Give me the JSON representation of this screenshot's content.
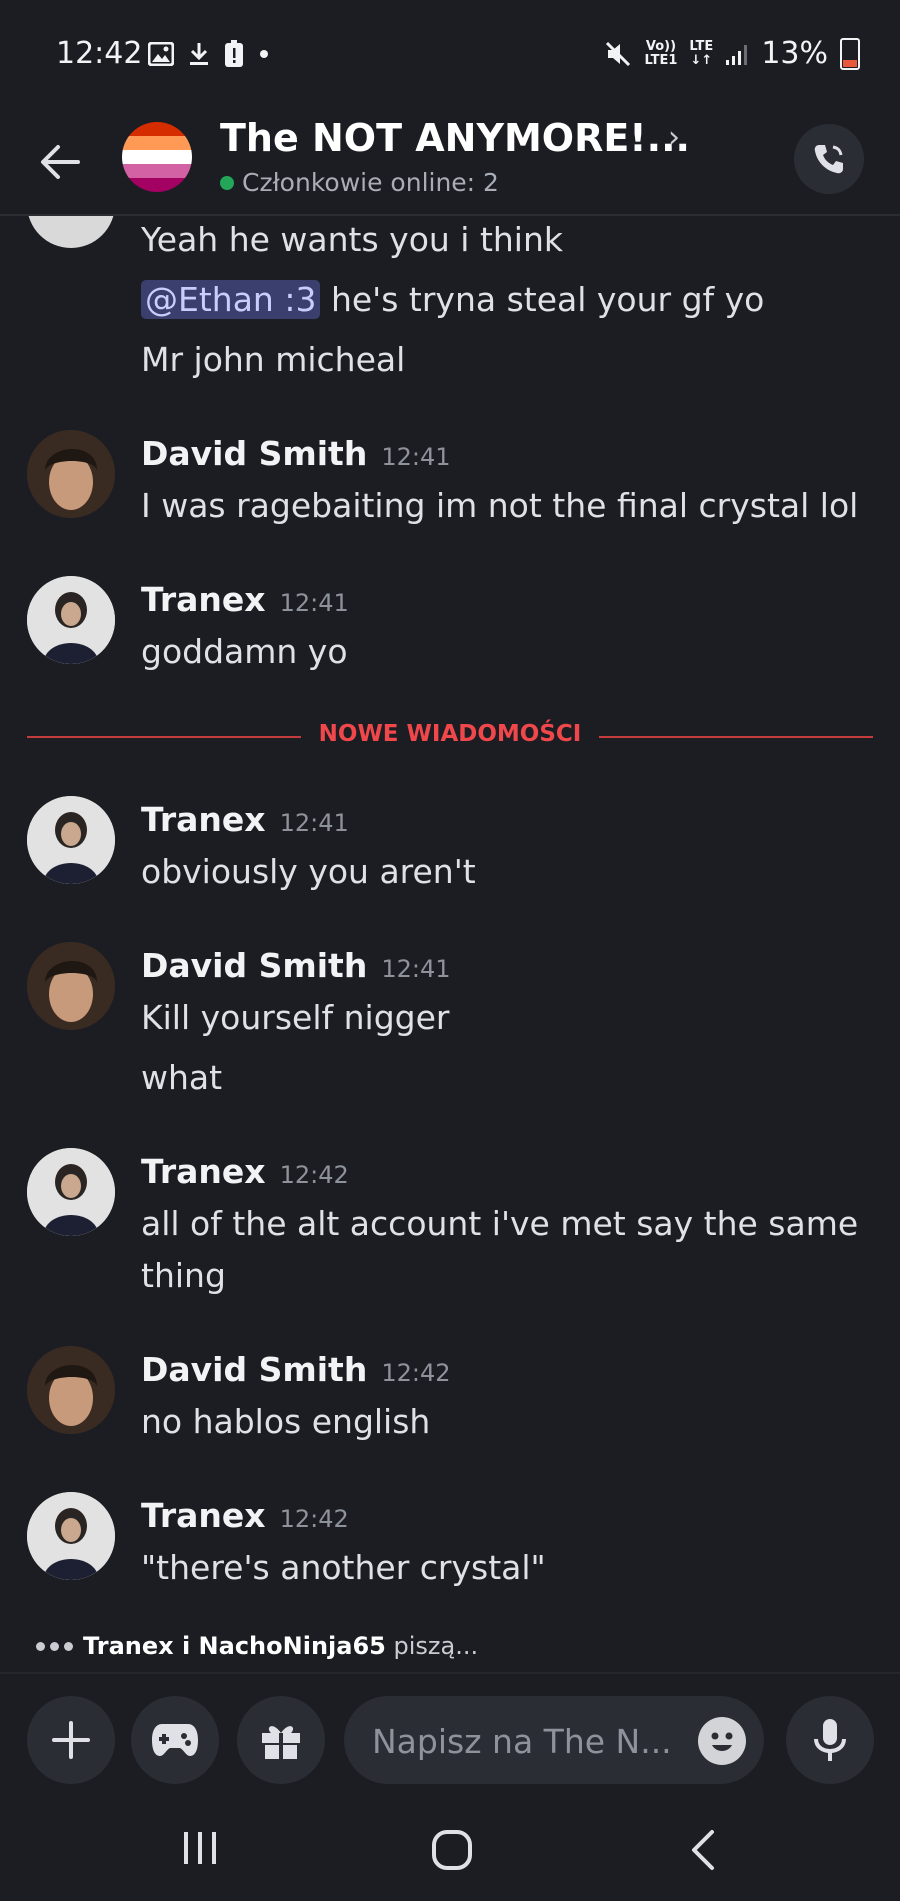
{
  "status_bar": {
    "time": "12:42",
    "network": [
      "Vo))",
      "LTE1",
      "LTE",
      "↓↑"
    ],
    "battery": "13%"
  },
  "header": {
    "title": "The NOT ANYMORE!...",
    "online": "Członkowie online: 2"
  },
  "messages_top": {
    "line1": "Yeah he wants you i think",
    "mention": "@Ethan :3",
    "line2_rest": "he's tryna steal your gf yo",
    "line3": "Mr john micheal"
  },
  "messages": [
    {
      "author": "David Smith",
      "time": "12:41",
      "lines": [
        "I was ragebaiting im not the final crystal lol"
      ]
    },
    {
      "author": "Tranex",
      "time": "12:41",
      "lines": [
        "goddamn yo"
      ]
    },
    {
      "author": "Tranex",
      "time": "12:41",
      "lines": [
        "obviously you aren't"
      ]
    },
    {
      "author": "David Smith",
      "time": "12:41",
      "lines": [
        "Kill yourself nigger",
        "what"
      ]
    },
    {
      "author": "Tranex",
      "time": "12:42",
      "lines": [
        "all of the alt account i've met say the same",
        "thing"
      ]
    },
    {
      "author": "David Smith",
      "time": "12:42",
      "lines": [
        "no hablos english"
      ]
    },
    {
      "author": "Tranex",
      "time": "12:42",
      "lines": [
        "\"there's another crystal\""
      ]
    }
  ],
  "new_messages_label": "NOWE WIADOMOŚCI",
  "typing": {
    "who": "Tranex i NachoNinja65",
    "suffix": " piszą..."
  },
  "composer": {
    "placeholder": "Napisz na The N..."
  },
  "colors": {
    "background": "#1b1d23",
    "mention": "#3b3f6e",
    "divider": "#c33b3b",
    "online": "#23a55a"
  },
  "icons": [
    "back-arrow-icon",
    "call-icon",
    "plus-icon",
    "gamepad-icon",
    "gift-icon",
    "emoji-icon",
    "microphone-icon",
    "recents-icon",
    "home-icon",
    "back-icon"
  ]
}
